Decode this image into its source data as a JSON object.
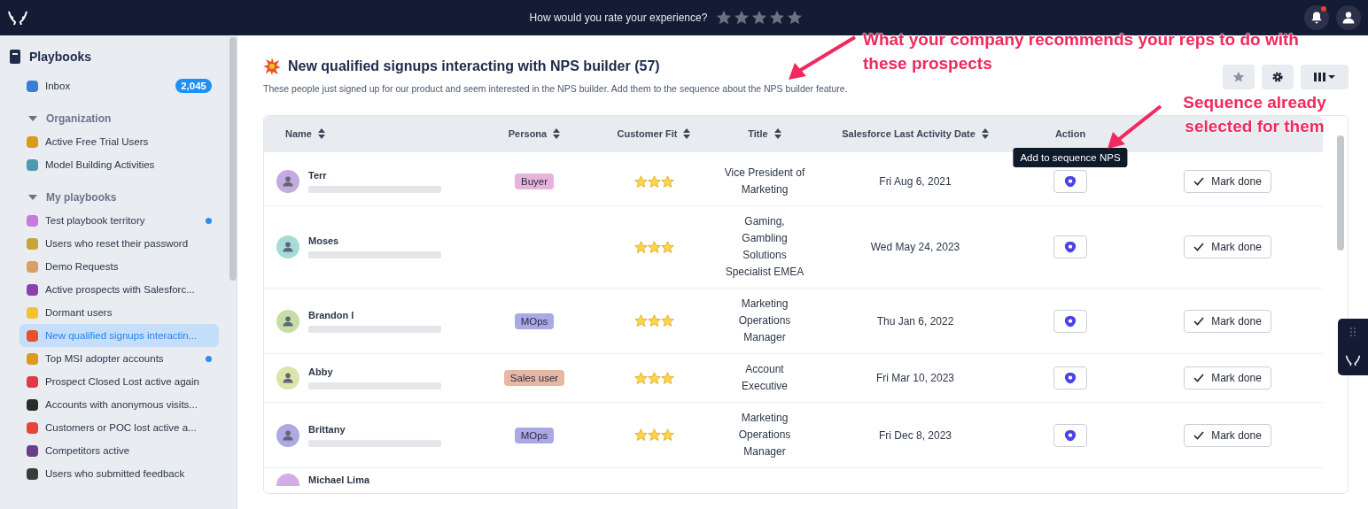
{
  "top_bar": {
    "rating_prompt": "How would you rate your experience?",
    "stars": 0,
    "notifications_unread": true
  },
  "sidebar": {
    "title": "Playbooks",
    "inbox": {
      "label": "Inbox",
      "badge": "2,045",
      "color": "#3a7fd6"
    },
    "groups": [
      {
        "label": "Organization",
        "expanded": true,
        "items": [
          {
            "label": "Active Free Trial Users",
            "color": "#d99a1e",
            "unread": false,
            "selected": false
          },
          {
            "label": "Model Building Activities",
            "color": "#4a9bb0",
            "unread": false,
            "selected": false
          }
        ]
      },
      {
        "label": "My playbooks",
        "expanded": true,
        "items": [
          {
            "label": "Test playbook territory",
            "color": "#c77be0",
            "unread": true,
            "selected": false
          },
          {
            "label": "Users who reset their password",
            "color": "#c9a43a",
            "unread": false,
            "selected": false
          },
          {
            "label": "Demo Requests",
            "color": "#d9a066",
            "unread": false,
            "selected": false
          },
          {
            "label": "Active prospects with Salesforc...",
            "color": "#8b3fb5",
            "unread": false,
            "selected": false
          },
          {
            "label": "Dormant users",
            "color": "#f2c230",
            "unread": false,
            "selected": false
          },
          {
            "label": "New qualified signups interactin...",
            "color": "#e8502a",
            "unread": false,
            "selected": true
          },
          {
            "label": "Top MSI adopter accounts",
            "color": "#d99a1e",
            "unread": true,
            "selected": false
          },
          {
            "label": "Prospect Closed Lost active again",
            "color": "#e0394a",
            "unread": false,
            "selected": false
          },
          {
            "label": "Accounts with anonymous visits...",
            "color": "#2b2b2b",
            "unread": false,
            "selected": false
          },
          {
            "label": "Customers or POC lost active a...",
            "color": "#e8453a",
            "unread": false,
            "selected": false
          },
          {
            "label": "Competitors active",
            "color": "#6a3f8a",
            "unread": false,
            "selected": false
          },
          {
            "label": "Users who submitted feedback",
            "color": "#3a3a3a",
            "unread": false,
            "selected": false
          }
        ]
      }
    ]
  },
  "playbook": {
    "title": "New qualified signups interacting with NPS builder (57)",
    "description": "These people just signed up for our product and seem interested in the NPS builder. Add them to the sequence about the NPS builder feature."
  },
  "table": {
    "columns": [
      {
        "label": "Name",
        "sortable": true
      },
      {
        "label": "Persona",
        "sortable": true
      },
      {
        "label": "Customer Fit",
        "sortable": true
      },
      {
        "label": "Title",
        "sortable": true
      },
      {
        "label": "Salesforce Last Activity Date",
        "sortable": true
      },
      {
        "label": "Action",
        "sortable": false
      }
    ],
    "rows": [
      {
        "name": "Terr",
        "color": "#c3aadf",
        "persona": {
          "label": "Buyer",
          "color": "#e6b3da"
        },
        "stars": 3,
        "title": "Vice President of Marketing",
        "date": "Fri Aug 6, 2021",
        "tooltip": "Add to sequence NPS",
        "done_label": "Mark done"
      },
      {
        "name": "Moses",
        "color": "#a6dcd8",
        "persona": null,
        "stars": 3,
        "title": "Gaming, Gambling Solutions Specialist EMEA",
        "date": "Wed May 24, 2023",
        "tooltip": null,
        "done_label": "Mark done"
      },
      {
        "name": "Brandon l",
        "color": "#c5dea6",
        "persona": {
          "label": "MOps",
          "color": "#aaa9e6"
        },
        "stars": 3,
        "title": "Marketing Operations Manager",
        "date": "Thu Jan 6, 2022",
        "tooltip": null,
        "done_label": "Mark done"
      },
      {
        "name": "Abby",
        "color": "#dde3ab",
        "persona": {
          "label": "Sales user",
          "color": "#e6b8a4"
        },
        "stars": 3,
        "title": "Account Executive",
        "date": "Fri Mar 10, 2023",
        "tooltip": null,
        "done_label": "Mark done"
      },
      {
        "name": "Brittany",
        "color": "#afa8e2",
        "persona": {
          "label": "MOps",
          "color": "#aaa9e6"
        },
        "stars": 3,
        "title": "Marketing Operations Manager",
        "date": "Fri Dec 8, 2023",
        "tooltip": null,
        "done_label": "Mark done"
      }
    ],
    "partial_row": {
      "name": "Michael Lima"
    }
  },
  "annotations": [
    "What your company recommends your reps to do with these prospects",
    "Sequence already selected for them"
  ]
}
